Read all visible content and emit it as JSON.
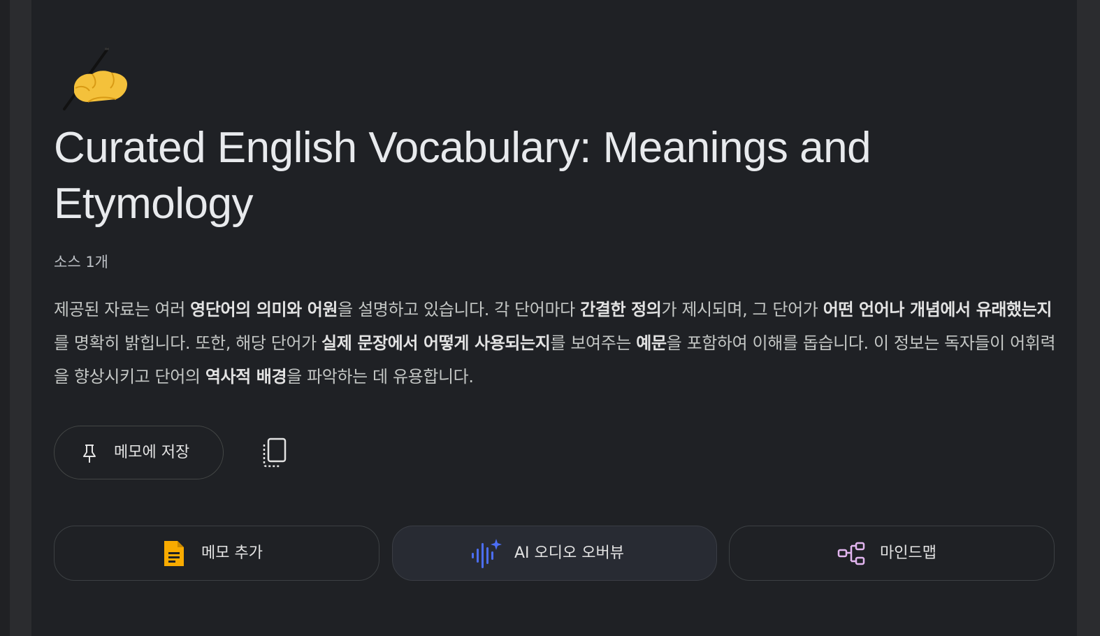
{
  "note": {
    "title": "Curated English Vocabulary: Meanings and Etymology",
    "source_count": "소스 1개",
    "summary": [
      {
        "text": "제공된 자료는 여러 ",
        "bold": false
      },
      {
        "text": "영단어의 의미와 어원",
        "bold": true
      },
      {
        "text": "을 설명하고 있습니다. 각 단어마다 ",
        "bold": false
      },
      {
        "text": "간결한 정의",
        "bold": true
      },
      {
        "text": "가 제시되며, 그 단어가 ",
        "bold": false
      },
      {
        "text": "어떤 언어나 개념에서 유래했는지",
        "bold": true
      },
      {
        "text": "를 명확히 밝힙니다. 또한, 해당 단어가 ",
        "bold": false
      },
      {
        "text": "실제 문장에서 어떻게 사용되는지",
        "bold": true
      },
      {
        "text": "를 보여주는 ",
        "bold": false
      },
      {
        "text": "예문",
        "bold": true
      },
      {
        "text": "을 포함하여 이해를 돕습니다. 이 정보는 독자들이 어휘력을 향상시키고 단어의 ",
        "bold": false
      },
      {
        "text": "역사적 배경",
        "bold": true
      },
      {
        "text": "을 파악하는 데 유용합니다.",
        "bold": false
      }
    ]
  },
  "buttons": {
    "save_label": "메모에 저장",
    "copy_icon": "copy-icon"
  },
  "actions": [
    {
      "label": "메모 추가",
      "icon": "document-icon",
      "color": "#f9ab00"
    },
    {
      "label": "AI 오디오 오버뷰",
      "icon": "audio-sparkle-icon",
      "color": "#4c6ef5"
    },
    {
      "label": "마인드맵",
      "icon": "mindmap-icon",
      "color": "#e3b6f0"
    }
  ]
}
